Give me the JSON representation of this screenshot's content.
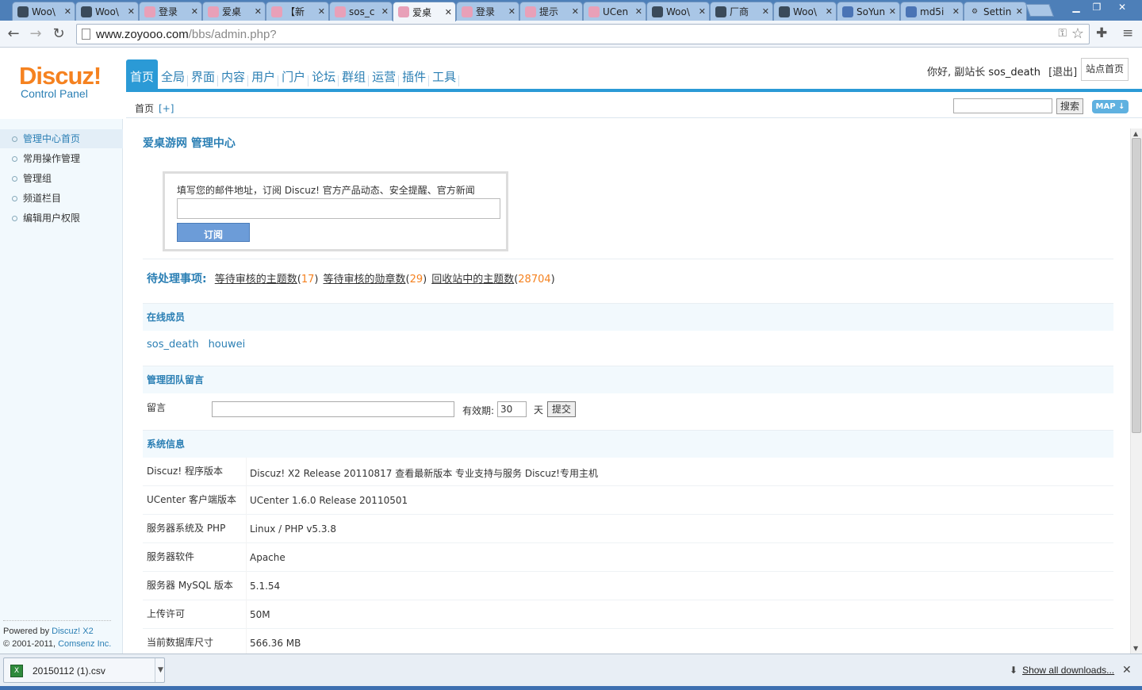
{
  "browser": {
    "tabs": [
      {
        "title": "Woo\\",
        "icon": "woo-icon"
      },
      {
        "title": "Woo\\",
        "icon": "woo-icon"
      },
      {
        "title": "登录",
        "icon": "dz-icon"
      },
      {
        "title": "爱桌",
        "icon": "dz-icon"
      },
      {
        "title": "【新",
        "icon": "dz-icon"
      },
      {
        "title": "sos_c",
        "icon": "dz-icon"
      },
      {
        "title": "爱桌",
        "icon": "dz-icon"
      },
      {
        "title": "登录",
        "icon": "dz-icon"
      },
      {
        "title": "提示",
        "icon": "dz-icon"
      },
      {
        "title": "UCen",
        "icon": "dz-icon"
      },
      {
        "title": "Woo\\",
        "icon": "woo-icon"
      },
      {
        "title": "厂商",
        "icon": "woo-icon"
      },
      {
        "title": "Woo\\",
        "icon": "woo-icon"
      },
      {
        "title": "SoYun",
        "icon": "search-icon"
      },
      {
        "title": "md5i",
        "icon": "grid-icon"
      },
      {
        "title": "Settin",
        "icon": "gear-icon"
      }
    ],
    "active_tab": 6,
    "url_host": "www.zoyooo.com",
    "url_path": "/bbs/admin.php?"
  },
  "header": {
    "logo_main": "Discuz!",
    "logo_sub": "Control Panel",
    "nav": [
      "首页",
      "全局",
      "界面",
      "内容",
      "用户",
      "门户",
      "论坛",
      "群组",
      "运营",
      "插件",
      "工具"
    ],
    "nav_selected": 0,
    "greeting": "你好, 副站长",
    "username": "sos_death",
    "logout": "[退出]",
    "site_home": "站点首页",
    "breadcrumb": "首页",
    "breadcrumb_add": "[+]",
    "search_button": "搜索",
    "map_button": "MAP"
  },
  "sidebar": {
    "items": [
      "管理中心首页",
      "常用操作管理",
      "管理组",
      "频道栏目",
      "编辑用户权限"
    ],
    "selected": 0,
    "powered_prefix": "Powered by ",
    "powered_brand": "Discuz! X2",
    "copyright_prefix": "© 2001-2011, ",
    "copyright_brand": "Comsenz Inc."
  },
  "main": {
    "title": "爱桌游网 管理中心",
    "subscribe": {
      "label": "填写您的邮件地址，订阅 Discuz! 官方产品动态、安全提醒、官方新闻",
      "email_value": "",
      "button": "订阅"
    },
    "pending": {
      "heading": "待处理事项:",
      "items": [
        {
          "label": "等待审核的主题数",
          "count": "17"
        },
        {
          "label": "等待审核的勋章数",
          "count": "29"
        },
        {
          "label": "回收站中的主题数",
          "count": "28704"
        }
      ]
    },
    "online_title": "在线成员",
    "online_members": [
      "sos_death",
      "houwei"
    ],
    "team_msg_title": "管理团队留言",
    "team_msg": {
      "label": "留言",
      "value": "",
      "validity_label": "有效期:",
      "validity_value": "30",
      "unit": "天",
      "submit": "提交"
    },
    "sysinfo_title": "系统信息",
    "sysinfo": [
      {
        "key": "Discuz! 程序版本",
        "value": "Discuz! X2 Release 20110817 查看最新版本 专业支持与服务 Discuz!专用主机"
      },
      {
        "key": "UCenter 客户端版本",
        "value": "UCenter 1.6.0 Release 20110501"
      },
      {
        "key": "服务器系统及 PHP",
        "value": "Linux / PHP v5.3.8"
      },
      {
        "key": "服务器软件",
        "value": "Apache"
      },
      {
        "key": "服务器 MySQL 版本",
        "value": "5.1.54"
      },
      {
        "key": "上传许可",
        "value": "50M"
      },
      {
        "key": "当前数据库尺寸",
        "value": "566.36 MB"
      }
    ]
  },
  "downloads": {
    "file": "20150112 (1).csv",
    "show_all": "Show all downloads..."
  },
  "colors": {
    "accent": "#2b9ad6",
    "link": "#2b7fb4",
    "orange": "#f58220"
  }
}
